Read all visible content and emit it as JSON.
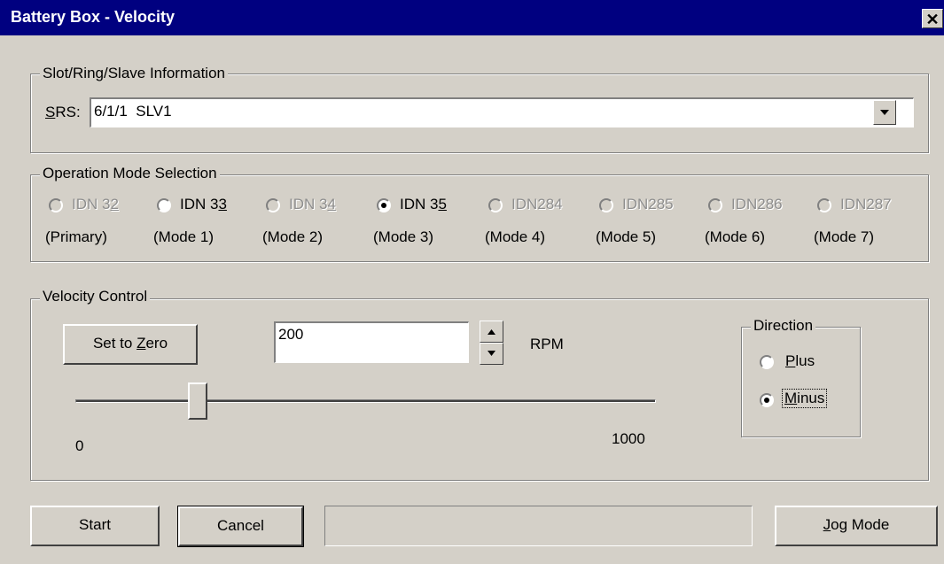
{
  "window": {
    "title": "Battery Box - Velocity",
    "close_glyph": "✕"
  },
  "srs_group": {
    "legend": "Slot/Ring/Slave Information",
    "label_accel": "S",
    "label_rest": "RS:",
    "value": "6/1/1  SLV1",
    "dropdown_icon": "chevron-down-icon"
  },
  "mode_group": {
    "legend": "Operation Mode Selection",
    "options": [
      {
        "pre": "IDN 3",
        "accel": "2",
        "post": "",
        "sub": "(Primary)",
        "enabled": false,
        "checked": false
      },
      {
        "pre": "IDN 3",
        "accel": "3",
        "post": "",
        "sub": "(Mode 1)",
        "enabled": true,
        "checked": false
      },
      {
        "pre": "IDN 3",
        "accel": "4",
        "post": "",
        "sub": "(Mode 2)",
        "enabled": false,
        "checked": false
      },
      {
        "pre": "IDN 3",
        "accel": "5",
        "post": "",
        "sub": "(Mode 3)",
        "enabled": true,
        "checked": true
      },
      {
        "pre": "IDN284",
        "accel": "",
        "post": "",
        "sub": "(Mode 4)",
        "enabled": false,
        "checked": false
      },
      {
        "pre": "IDN285",
        "accel": "",
        "post": "",
        "sub": "(Mode 5)",
        "enabled": false,
        "checked": false
      },
      {
        "pre": "IDN286",
        "accel": "",
        "post": "",
        "sub": "(Mode 6)",
        "enabled": false,
        "checked": false
      },
      {
        "pre": "IDN287",
        "accel": "",
        "post": "",
        "sub": "(Mode 7)",
        "enabled": false,
        "checked": false
      }
    ]
  },
  "velocity_group": {
    "legend": "Velocity Control",
    "set_zero": {
      "pre": "Set to ",
      "accel": "Z",
      "post": "ero"
    },
    "speed_value": "200",
    "unit": "RPM",
    "slider": {
      "min_label": "0",
      "max_label": "1000",
      "value_fraction": 0.2
    },
    "direction": {
      "legend": "Direction",
      "plus": {
        "accel": "P",
        "rest": "lus",
        "checked": false
      },
      "minus": {
        "accel": "M",
        "rest": "inus",
        "checked": true
      }
    }
  },
  "footer": {
    "start_label": "Start",
    "cancel_label": "Cancel",
    "status_text": "",
    "jog": {
      "accel": "J",
      "rest": "og Mode"
    }
  }
}
